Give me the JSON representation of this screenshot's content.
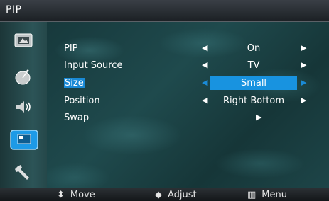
{
  "title": "PIP",
  "menu": [
    {
      "label": "PIP",
      "value": "On",
      "selected": false
    },
    {
      "label": "Input Source",
      "value": "TV",
      "selected": false
    },
    {
      "label": "Size",
      "value": "Small",
      "selected": true
    },
    {
      "label": "Position",
      "value": "Right Bottom",
      "selected": false
    },
    {
      "label": "Swap",
      "value": "",
      "selected": false
    }
  ],
  "sidebar": [
    "picture-icon",
    "channel-icon",
    "sound-icon",
    "setup-icon",
    "support-icon"
  ],
  "footer": {
    "move": "Move",
    "adjust": "Adjust",
    "menu": "Menu"
  },
  "colors": {
    "accent": "#1893e0",
    "background": "#1f4a4d"
  }
}
